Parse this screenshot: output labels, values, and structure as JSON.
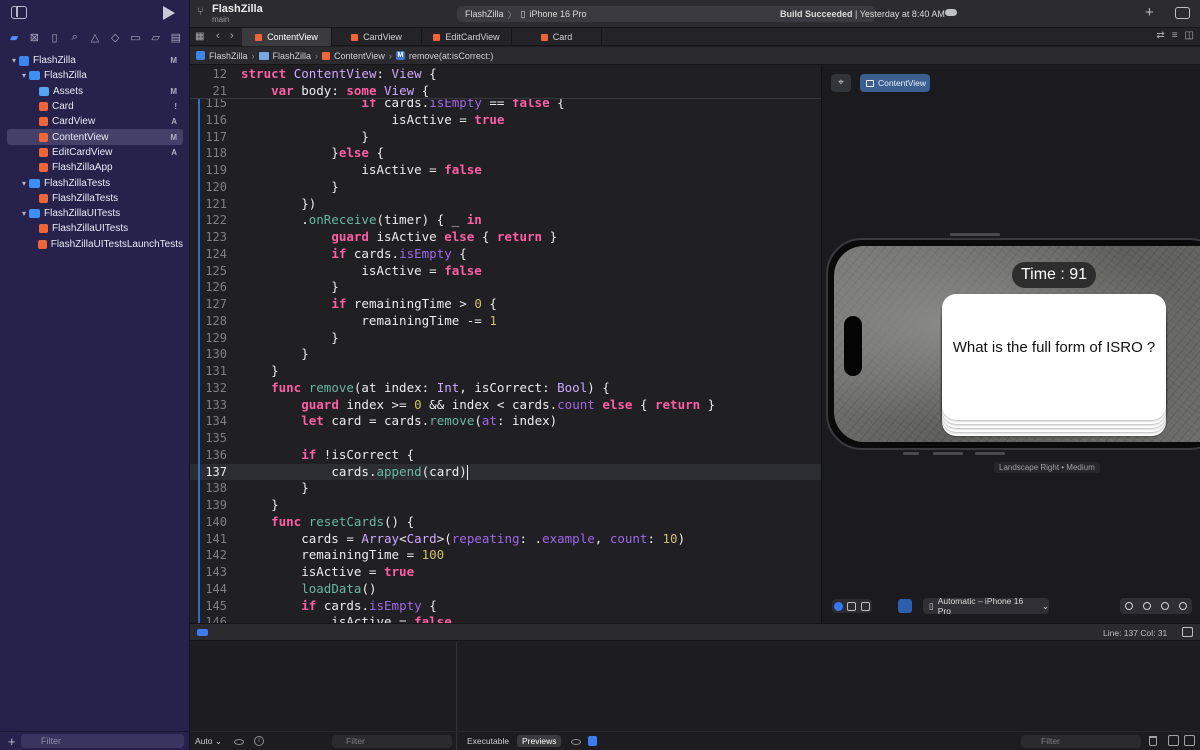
{
  "sidebar": {
    "filter_placeholder": "Filter",
    "add_label": "+",
    "tree": [
      {
        "label": "FlashZilla",
        "kind": "project",
        "indent": 0,
        "chevron": "▾",
        "badge": "M",
        "selected": false
      },
      {
        "label": "FlashZilla",
        "kind": "folder",
        "indent": 1,
        "chevron": "▾",
        "badge": "",
        "selected": false
      },
      {
        "label": "Assets",
        "kind": "assets",
        "indent": 2,
        "chevron": "",
        "badge": "M",
        "selected": false
      },
      {
        "label": "Card",
        "kind": "swift",
        "indent": 2,
        "chevron": "",
        "badge": "!",
        "selected": false
      },
      {
        "label": "CardView",
        "kind": "swift",
        "indent": 2,
        "chevron": "",
        "badge": "A",
        "selected": false
      },
      {
        "label": "ContentView",
        "kind": "swift",
        "indent": 2,
        "chevron": "",
        "badge": "M",
        "selected": true
      },
      {
        "label": "EditCardView",
        "kind": "swift",
        "indent": 2,
        "chevron": "",
        "badge": "A",
        "selected": false
      },
      {
        "label": "FlashZillaApp",
        "kind": "swift",
        "indent": 2,
        "chevron": "",
        "badge": "",
        "selected": false
      },
      {
        "label": "FlashZillaTests",
        "kind": "folder",
        "indent": 1,
        "chevron": "▾",
        "badge": "",
        "selected": false
      },
      {
        "label": "FlashZillaTests",
        "kind": "swift",
        "indent": 2,
        "chevron": "",
        "badge": "",
        "selected": false
      },
      {
        "label": "FlashZillaUITests",
        "kind": "folder",
        "indent": 1,
        "chevron": "▾",
        "badge": "",
        "selected": false
      },
      {
        "label": "FlashZillaUITests",
        "kind": "swift",
        "indent": 2,
        "chevron": "",
        "badge": "",
        "selected": false
      },
      {
        "label": "FlashZillaUITestsLaunchTests",
        "kind": "swift",
        "indent": 2,
        "chevron": "",
        "badge": "",
        "selected": false
      }
    ]
  },
  "toolbar": {
    "project": "FlashZilla",
    "branch": "main",
    "scheme": "FlashZilla",
    "destination": "iPhone 16 Pro",
    "build_status_bold": "Build Succeeded",
    "build_status_rest": " | Yesterday at 8:40 AM"
  },
  "tabs": [
    "ContentView",
    "CardView",
    "EditCardView",
    "Card"
  ],
  "active_tab": 0,
  "jumpbar": [
    "FlashZilla",
    "FlashZilla",
    "ContentView",
    "remove(at:isCorrect:)"
  ],
  "editor": {
    "current_line": 137,
    "sticky": [
      {
        "n": "12",
        "code": "struct ContentView: View {"
      },
      {
        "n": "21",
        "code": "    var body: some View {"
      }
    ],
    "lines": [
      {
        "n": "115",
        "code": "                if cards.isEmpty == false {"
      },
      {
        "n": "116",
        "code": "                    isActive = true"
      },
      {
        "n": "117",
        "code": "                }"
      },
      {
        "n": "118",
        "code": "            }else {"
      },
      {
        "n": "119",
        "code": "                isActive = false"
      },
      {
        "n": "120",
        "code": "            }"
      },
      {
        "n": "121",
        "code": "        })"
      },
      {
        "n": "122",
        "code": "        .onReceive(timer) { _ in"
      },
      {
        "n": "123",
        "code": "            guard isActive else { return }"
      },
      {
        "n": "124",
        "code": "            if cards.isEmpty {"
      },
      {
        "n": "125",
        "code": "                isActive = false"
      },
      {
        "n": "126",
        "code": "            }"
      },
      {
        "n": "127",
        "code": "            if remainingTime > 0 {"
      },
      {
        "n": "128",
        "code": "                remainingTime -= 1"
      },
      {
        "n": "129",
        "code": "            }"
      },
      {
        "n": "130",
        "code": "        }"
      },
      {
        "n": "131",
        "code": "    }"
      },
      {
        "n": "132",
        "code": "    func remove(at index: Int, isCorrect: Bool) {"
      },
      {
        "n": "133",
        "code": "        guard index >= 0 && index < cards.count else { return }"
      },
      {
        "n": "134",
        "code": "        let card = cards.remove(at: index)"
      },
      {
        "n": "135",
        "code": ""
      },
      {
        "n": "136",
        "code": "        if !isCorrect {"
      },
      {
        "n": "137",
        "code": "            cards.append(card)"
      },
      {
        "n": "138",
        "code": "        }"
      },
      {
        "n": "139",
        "code": "    }"
      },
      {
        "n": "140",
        "code": "    func resetCards() {"
      },
      {
        "n": "141",
        "code": "        cards = Array<Card>(repeating: .example, count: 10)"
      },
      {
        "n": "142",
        "code": "        remainingTime = 100"
      },
      {
        "n": "143",
        "code": "        isActive = true"
      },
      {
        "n": "144",
        "code": "        loadData()"
      },
      {
        "n": "145",
        "code": "        if cards.isEmpty {"
      },
      {
        "n": "146",
        "code": "            isActive = false"
      }
    ]
  },
  "preview": {
    "chip": "ContentView",
    "timer": "Time : 91",
    "question": "What is the full form of ISRO ?",
    "orientation": "Landscape Right • Medium",
    "device_picker": "Automatic – iPhone 16 Pro"
  },
  "status": {
    "line_col": "Line: 137  Col: 31"
  },
  "debug": {
    "auto": "Auto ⌄",
    "left_filter": "Filter",
    "right_filter": "Filter",
    "tab_executable": "Executable",
    "tab_previews": "Previews"
  },
  "colors": {
    "keyword": "#fc5fa3",
    "type": "#d0a8ff",
    "function": "#67b7a4",
    "property": "#a167e6",
    "number": "#d0bf69",
    "sidebar_bg": "#27224c",
    "accent": "#3478f6"
  }
}
